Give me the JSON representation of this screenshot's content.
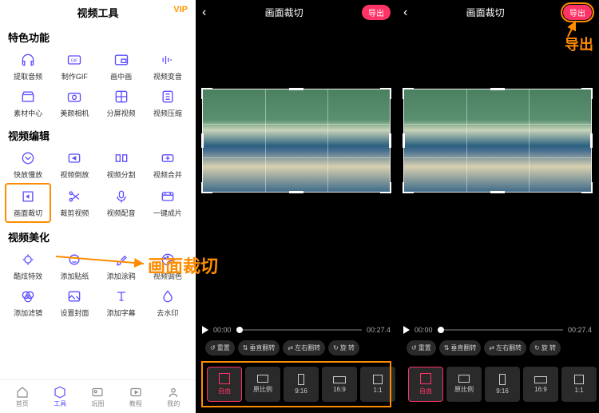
{
  "app": {
    "title": "视频工具",
    "vip": "VIP"
  },
  "sections": {
    "featured": {
      "title": "特色功能",
      "items": [
        {
          "label": "提取音频"
        },
        {
          "label": "制作GIF"
        },
        {
          "label": "画中画"
        },
        {
          "label": "视频变音"
        },
        {
          "label": "素材中心"
        },
        {
          "label": "美颜相机"
        },
        {
          "label": "分屏视频"
        },
        {
          "label": "视频压缩"
        }
      ]
    },
    "edit": {
      "title": "视频编辑",
      "items": [
        {
          "label": "快放慢放"
        },
        {
          "label": "视频倒放"
        },
        {
          "label": "视频分割"
        },
        {
          "label": "视频合并"
        },
        {
          "label": "画面裁切"
        },
        {
          "label": "裁剪视频"
        },
        {
          "label": "视频配音"
        },
        {
          "label": "一键成片"
        }
      ]
    },
    "beautify": {
      "title": "视频美化",
      "items": [
        {
          "label": "酷炫特效"
        },
        {
          "label": "添加贴纸"
        },
        {
          "label": "添加涂鸦"
        },
        {
          "label": "视频调色"
        },
        {
          "label": "添加滤镜"
        },
        {
          "label": "设置封面"
        },
        {
          "label": "添加字幕"
        },
        {
          "label": "去水印"
        }
      ]
    }
  },
  "bottom_nav": [
    {
      "label": "首页"
    },
    {
      "label": "工具"
    },
    {
      "label": "玩图"
    },
    {
      "label": "教程"
    },
    {
      "label": "我的"
    }
  ],
  "editor": {
    "title": "画面裁切",
    "export": "导出",
    "time_start": "00:00",
    "time_end": "00:27.4",
    "ops": [
      {
        "label": "重置",
        "icon": "↺"
      },
      {
        "label": "垂直翻转",
        "icon": "⇅"
      },
      {
        "label": "左右翻转",
        "icon": "⇄"
      },
      {
        "label": "旋 转",
        "icon": "↻"
      }
    ],
    "ratios": [
      {
        "label": "自由"
      },
      {
        "label": "原比例"
      },
      {
        "label": "9:16"
      },
      {
        "label": "16:9"
      },
      {
        "label": "1:1"
      }
    ]
  },
  "annotations": {
    "crop_label": "画面裁切",
    "export_label": "导出"
  }
}
